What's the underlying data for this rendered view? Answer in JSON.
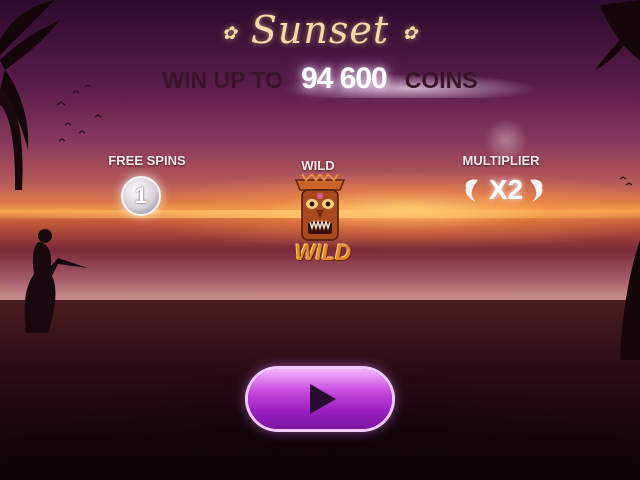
{
  "header": {
    "title": "Sunset",
    "title_ornament": "✿"
  },
  "win_banner": {
    "prefix": "WIN UP TO",
    "amount": "94 600",
    "suffix": "COINS"
  },
  "features": {
    "free_spins": {
      "label": "FREE SPINS",
      "value": "1"
    },
    "wild": {
      "label": "WILD",
      "symbol_text": "WILD"
    },
    "multiplier": {
      "label": "MULTIPLIER",
      "value": "X2"
    }
  },
  "play_button": {
    "icon": "play-icon"
  },
  "colors": {
    "title": "#f6d9a8",
    "button": "#b43ad6",
    "wild_text": "#e08a2a"
  }
}
